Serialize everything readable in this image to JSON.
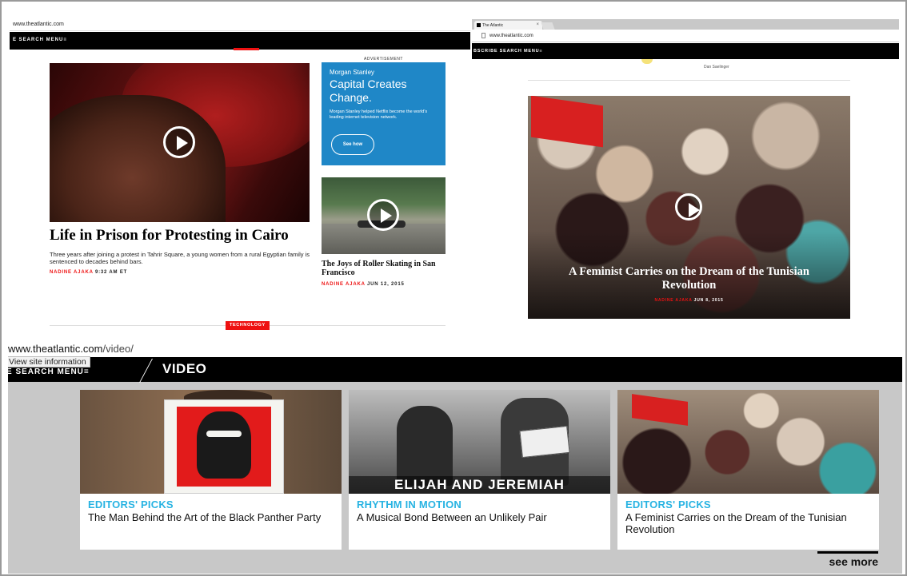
{
  "panel1": {
    "url": "www.theatlantic.com",
    "nav": "E  SEARCH  MENU≡",
    "main_story": {
      "headline": "Life in Prison for Protesting in Cairo",
      "dek": "Three years after joining a protest in Tahrir Square, a young women from a rural Egyptian family is sentenced to decades behind bars.",
      "author": "NADINE AJAKA",
      "time": "9:32 AM ET"
    },
    "advertisement": {
      "label": "ADVERTISEMENT",
      "brand": "Morgan Stanley",
      "headline": "Capital Creates Change.",
      "body": "Morgan Stanley helped Netflix become the world's leading internet television network.",
      "button": "See how"
    },
    "side_story": {
      "headline": "The Joys of Roller Skating in San Francisco",
      "author": "NADINE AJAKA",
      "time": "JUN 12, 2015"
    },
    "section_tag": "TECHNOLOGY"
  },
  "panel2": {
    "tab_title": "The Atlantic",
    "tab_close": "×",
    "url": "www.theatlantic.com",
    "nav": "BSCRIBE  SEARCH  MENU≡",
    "photo_credit": "Dan Saelinger",
    "story": {
      "headline": "A Feminist Carries on the Dream of the Tunisian Revolution",
      "author": "NADINE AJAKA",
      "time": "JUN 8, 2015"
    }
  },
  "panel3": {
    "url_domain": "www.theatlantic.com",
    "url_path": "/video/",
    "tooltip": "View site information",
    "nav": "E  SEARCH  MENU≡",
    "section": "VIDEO",
    "cards": [
      {
        "kicker": "EDITORS' PICKS",
        "title": "The Man Behind the Art of the Black Panther Party"
      },
      {
        "kicker": "RHYTHM IN MOTION",
        "title": "A Musical Bond Between an Unlikely Pair",
        "image_text": "ELIJAH AND JEREMIAH"
      },
      {
        "kicker": "EDITORS' PICKS",
        "title": "A Feminist Carries on the Dream of the Tunisian Revolution"
      }
    ],
    "see_more": "see more"
  },
  "colors": {
    "accent_red": "#ee1111",
    "kicker_blue": "#27b3e2",
    "ad_blue": "#1f87c7"
  }
}
